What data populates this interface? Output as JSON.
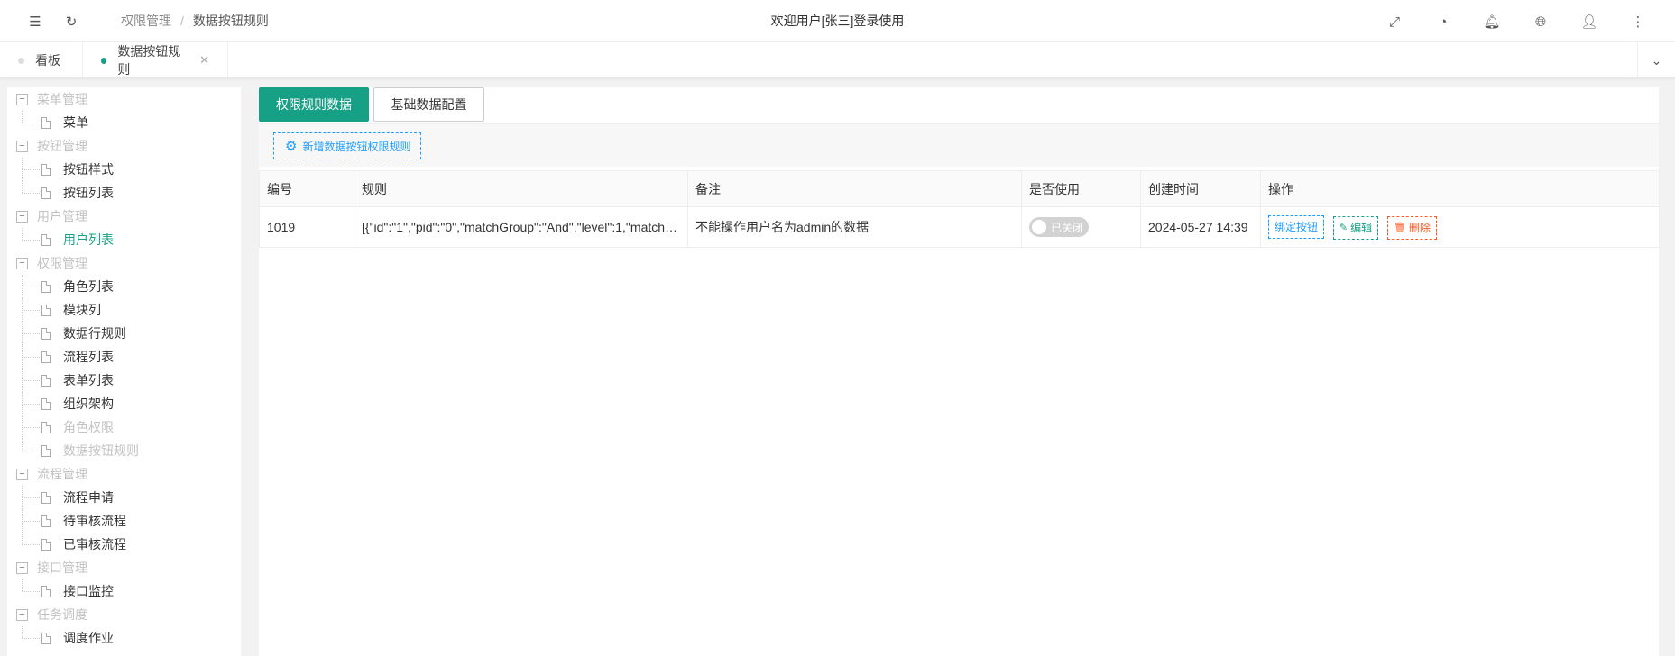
{
  "header": {
    "breadcrumb": [
      "权限管理",
      "数据按钮规则"
    ],
    "welcome": "欢迎用户[张三]登录使用",
    "icons": [
      "menu-fold-icon",
      "refresh-icon",
      "fullscreen-icon",
      "theme-icon",
      "bell-icon",
      "globe-icon",
      "user-icon",
      "more-icon"
    ]
  },
  "tabs": [
    {
      "label": "看板",
      "active": false
    },
    {
      "label": "数据按钮规则",
      "active": true,
      "closable": true
    }
  ],
  "sidebar": {
    "groups": [
      {
        "label": "菜单管理",
        "items": [
          {
            "label": "菜单"
          }
        ]
      },
      {
        "label": "按钮管理",
        "items": [
          {
            "label": "按钮样式"
          },
          {
            "label": "按钮列表"
          }
        ]
      },
      {
        "label": "用户管理",
        "items": [
          {
            "label": "用户列表",
            "highlight": true
          }
        ]
      },
      {
        "label": "权限管理",
        "items": [
          {
            "label": "角色列表"
          },
          {
            "label": "模块列"
          },
          {
            "label": "数据行规则"
          },
          {
            "label": "流程列表"
          },
          {
            "label": "表单列表"
          },
          {
            "label": "组织架构"
          },
          {
            "label": "角色权限",
            "disabled": true
          },
          {
            "label": "数据按钮规则",
            "disabled": true
          }
        ]
      },
      {
        "label": "流程管理",
        "items": [
          {
            "label": "流程申请"
          },
          {
            "label": "待审核流程"
          },
          {
            "label": "已审核流程"
          }
        ]
      },
      {
        "label": "接口管理",
        "items": [
          {
            "label": "接口监控"
          }
        ]
      },
      {
        "label": "任务调度",
        "items": [
          {
            "label": "调度作业"
          }
        ]
      }
    ]
  },
  "main": {
    "tab_buttons": [
      "权限规则数据",
      "基础数据配置"
    ],
    "add_button": "新增数据按钮权限规则",
    "columns": [
      "编号",
      "规则",
      "备注",
      "是否使用",
      "创建时间",
      "操作"
    ],
    "rows": [
      {
        "id": "1019",
        "rule": "[{\"id\":\"1\",\"pid\":\"0\",\"matchGroup\":\"And\",\"level\":1,\"matchingWhere\":\"...",
        "remark": "不能操作用户名为admin的数据",
        "enabled_label": "已关闭",
        "created": "2024-05-27 14:39",
        "actions": [
          "绑定按钮",
          "编辑",
          "删除"
        ]
      }
    ]
  },
  "colors": {
    "primary": "#16a085",
    "info": "#1e9fff",
    "danger": "#ff5722"
  }
}
